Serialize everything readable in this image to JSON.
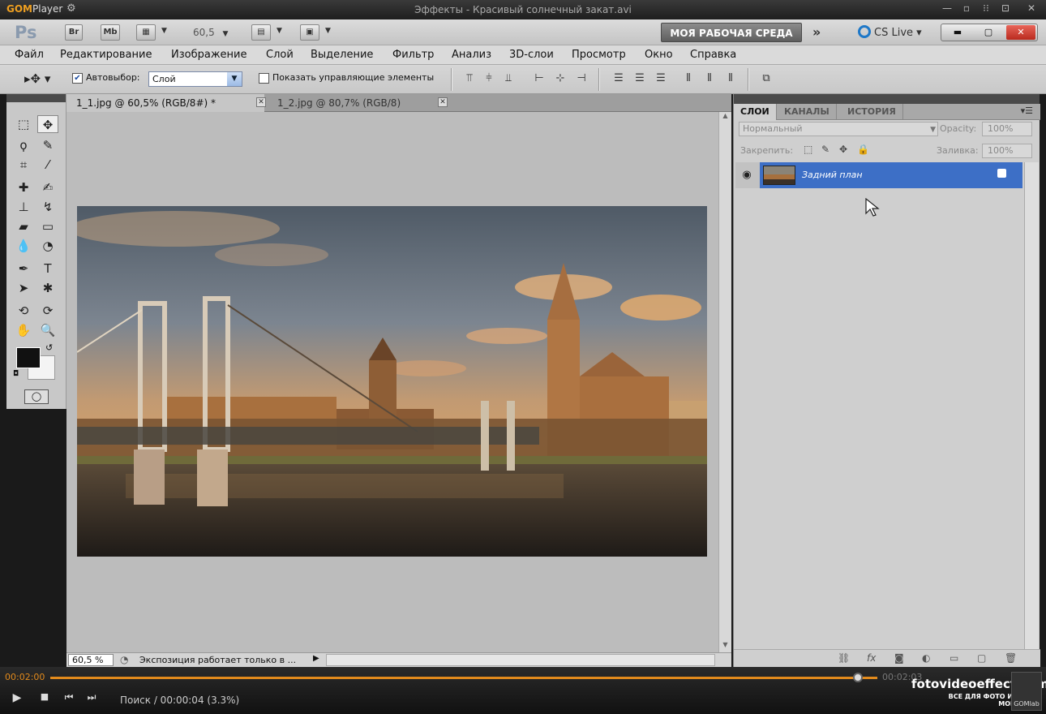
{
  "gom": {
    "logo_gom": "GOM",
    "logo_player": "Player",
    "window_title": "Эффекты - Красивый солнечный закат.avi",
    "time_elapsed": "00:02:00",
    "time_total": "00:02:03",
    "status": "Поиск / 00:00:04 (3.3%)",
    "progress_fraction": 0.976,
    "watermark_site": "fotovideoeffect.com",
    "watermark_slogan": "ВСЕ ДЛЯ ФОТО И ВИДЕО МОНТАЖА!",
    "gomlab": "GOMlab"
  },
  "ps": {
    "logo": "Ps",
    "appbar": {
      "br": "Br",
      "mb": "Mb",
      "zoom": "60,5",
      "workspace": "МОЯ РАБОЧАЯ СРЕДА",
      "cslive": "CS Live"
    },
    "menu": [
      "Файл",
      "Редактирование",
      "Изображение",
      "Слой",
      "Выделение",
      "Фильтр",
      "Анализ",
      "3D-слои",
      "Просмотр",
      "Окно",
      "Справка"
    ],
    "options": {
      "autoselect_label": "Автовыбор:",
      "autoselect_checked": true,
      "autoselect_value": "Слой",
      "show_controls_label": "Показать управляющие элементы",
      "show_controls_checked": false
    },
    "doc_tabs": [
      {
        "label": "1_1.jpg @ 60,5% (RGB/8#) *",
        "active": true
      },
      {
        "label": "1_2.jpg @ 80,7% (RGB/8)",
        "active": false
      }
    ],
    "status": {
      "zoom": "60,5 %",
      "text": "Экспозиция работает только в ..."
    },
    "panel": {
      "tabs": [
        "СЛОИ",
        "КАНАЛЫ",
        "ИСТОРИЯ"
      ],
      "blend_mode": "Нормальный",
      "opacity_label": "Opacity:",
      "opacity_value": "100%",
      "lock_label": "Закрепить:",
      "fill_label": "Заливка:",
      "fill_value": "100%",
      "layer_name": "Задний план"
    }
  },
  "colors": {
    "gom_accent": "#e28a1c",
    "layer_selected": "#3d6fc6",
    "foreground": "#111111",
    "background": "#f4f4f4"
  }
}
